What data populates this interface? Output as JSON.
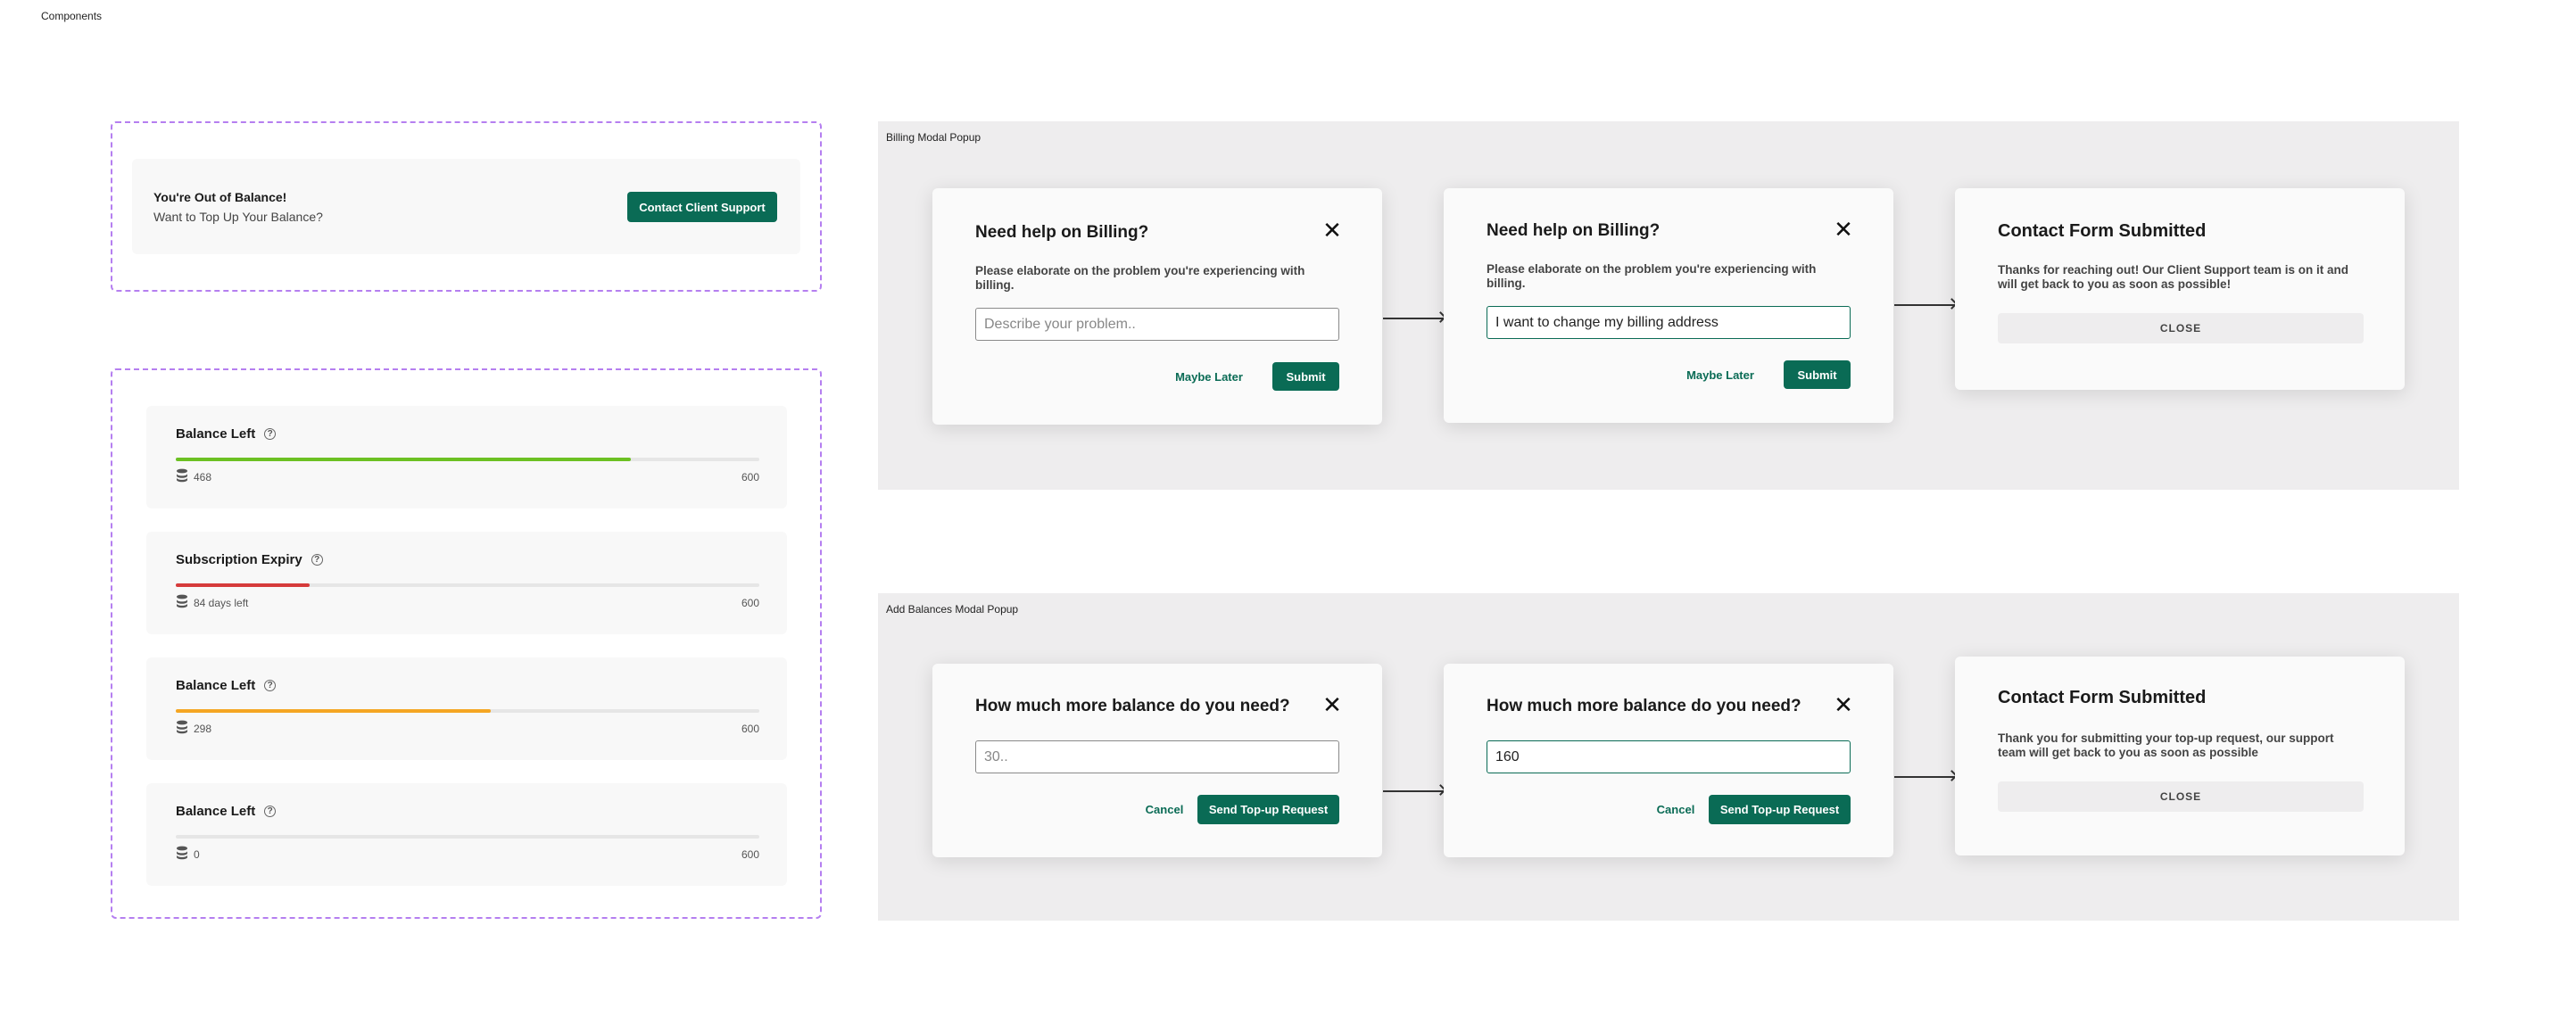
{
  "canvas": {
    "title": "Components"
  },
  "colors": {
    "primary": "#0a6b55",
    "frame_dashed": "#b57ff0",
    "panel_bg": "#eeedee",
    "bar_green": "#6cc123",
    "bar_red": "#d63b3b",
    "bar_orange": "#f5a623"
  },
  "out_of_balance": {
    "title": "You're Out of Balance!",
    "subtitle": "Want to Top Up Your Balance?",
    "button": "Contact Client Support"
  },
  "balance_cards": [
    {
      "title": "Balance Left",
      "help_icon": "help-circle-icon",
      "value_label": "468",
      "max_label": "600",
      "progress": 0.78,
      "bar_color": "#6cc123",
      "icon": "stack-coins-icon"
    },
    {
      "title": "Subscription Expiry",
      "help_icon": "help-circle-icon",
      "value_label": "84 days left",
      "max_label": "600",
      "progress": 0.23,
      "bar_color": "#d63b3b",
      "icon": "stack-coins-icon"
    },
    {
      "title": "Balance Left",
      "help_icon": "help-circle-icon",
      "value_label": "298",
      "max_label": "600",
      "progress": 0.54,
      "bar_color": "#f5a623",
      "icon": "stack-coins-icon"
    },
    {
      "title": "Balance Left",
      "help_icon": "help-circle-icon",
      "value_label": "0",
      "max_label": "600",
      "progress": 0,
      "bar_color": "#e6e6e6",
      "icon": "stack-coins-icon"
    }
  ],
  "billing_flow": {
    "label": "Billing Modal Popup",
    "modal_empty": {
      "title": "Need help on Billing?",
      "description": "Please elaborate on the problem you're experiencing with billing.",
      "input_placeholder": "Describe your problem..",
      "input_value": "",
      "secondary": "Maybe Later",
      "primary": "Submit"
    },
    "modal_filled": {
      "title": "Need help on Billing?",
      "description": "Please elaborate on the problem you're experiencing with billing.",
      "input_value": "I want to change my billing address",
      "secondary": "Maybe Later",
      "primary": "Submit"
    },
    "success": {
      "title": "Contact Form Submitted",
      "description": "Thanks for reaching out! Our Client Support team is on it and will get back to you as soon as possible!",
      "button": "CLOSE"
    }
  },
  "balance_flow": {
    "label": "Add Balances Modal Popup",
    "modal_empty": {
      "title": "How much more balance do you need?",
      "input_placeholder": "30..",
      "input_value": "",
      "secondary": "Cancel",
      "primary": "Send Top-up Request"
    },
    "modal_filled": {
      "title": "How much more balance do you need?",
      "input_value": "160",
      "secondary": "Cancel",
      "primary": "Send Top-up Request"
    },
    "success": {
      "title": "Contact Form Submitted",
      "description": "Thank you for submitting your top-up request, our support team will get back to you as soon as possible",
      "button": "CLOSE"
    }
  }
}
